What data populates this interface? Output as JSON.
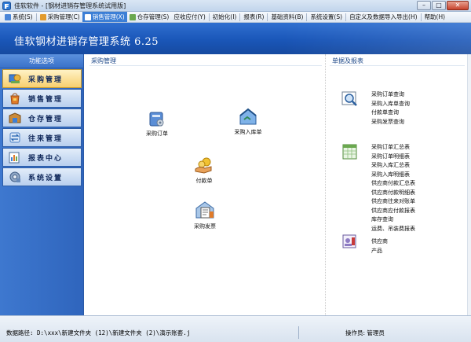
{
  "window": {
    "title": "佳软软件 - [钢材进销存管理系统试用版]",
    "buttons": {
      "minimize": "–",
      "maximize": "□",
      "close": "✕"
    }
  },
  "menu": [
    {
      "label": "系统(S)",
      "active": false
    },
    {
      "label": "采购管理(C)",
      "active": false
    },
    {
      "label": "销售管理(X)",
      "active": true
    },
    {
      "label": "仓存管理(S)",
      "active": false
    },
    {
      "label": "应收应付(Y)",
      "active": false
    },
    {
      "label": "初始化(I)",
      "active": false
    },
    {
      "label": "报表(R)",
      "active": false
    },
    {
      "label": "基础资料(B)",
      "active": false
    },
    {
      "label": "系统设置(S)",
      "active": false
    },
    {
      "label": "自定义及数据导入导出(H)",
      "active": false
    },
    {
      "label": "帮助(H)",
      "active": false
    }
  ],
  "banner": {
    "title": "佳软钢材进销存管理系统 6.25"
  },
  "sidebar": {
    "header": "功能选项",
    "items": [
      {
        "label": "采购管理",
        "active": true
      },
      {
        "label": "销售管理",
        "active": false
      },
      {
        "label": "仓存管理",
        "active": false
      },
      {
        "label": "往来管理",
        "active": false
      },
      {
        "label": "报表中心",
        "active": false
      },
      {
        "label": "系统设置",
        "active": false
      }
    ]
  },
  "main": {
    "section_title": "采购管理",
    "tools": {
      "purchase_order": "采购订单",
      "purchase_receipt": "采购入库单",
      "payment": "付款单",
      "purchase_invoice": "采购发票"
    },
    "reports_title": "单据及报表",
    "reports": {
      "group1": [
        "采购订单查询",
        "采购入库单查询",
        "付款单查询",
        "采购发票查询"
      ],
      "group2": [
        "采购订单汇总表",
        "采购订单明细表",
        "采购入库汇总表",
        "采购入库明细表",
        "供应商付款汇总表",
        "供应商付款明细表",
        "供应商往来对账单",
        "供应商应付款报表",
        "库存查询",
        "运费、吊装费报表"
      ],
      "group3": [
        "供应商",
        "产品"
      ]
    }
  },
  "status": {
    "path": "数据路径: D:\\xxx\\新建文件夹 (12)\\新建文件夹 (2)\\演示账套.j",
    "operator": "操作员: 管理员"
  }
}
